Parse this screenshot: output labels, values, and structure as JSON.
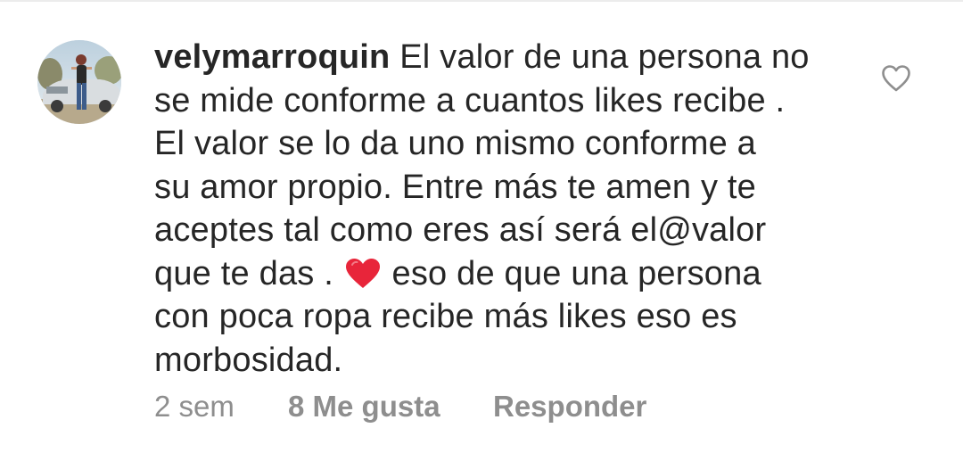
{
  "comment": {
    "username": "velymarroquin",
    "avatar_icon": "user-avatar-photo",
    "text_lines": [
      "El valor de una persona no",
      "se mide conforme a cuantos likes recibe .",
      "El valor se lo da uno mismo conforme a",
      "su amor propio. Entre más te amen y te",
      "aceptes tal como eres así será el@valor",
      "que te das . ",
      " eso de que una persona",
      "con poca ropa recibe más likes eso es",
      "morbosidad."
    ],
    "emoji": "red-heart-emoji",
    "like_icon": "heart-outline-icon",
    "time": "2 sem",
    "likes_label": "8 Me gusta",
    "reply_label": "Responder"
  },
  "colors": {
    "text": "#262626",
    "meta": "#8e8e8e",
    "heart_emoji": "#e8253a",
    "like_icon_stroke": "#8e8e8e"
  }
}
